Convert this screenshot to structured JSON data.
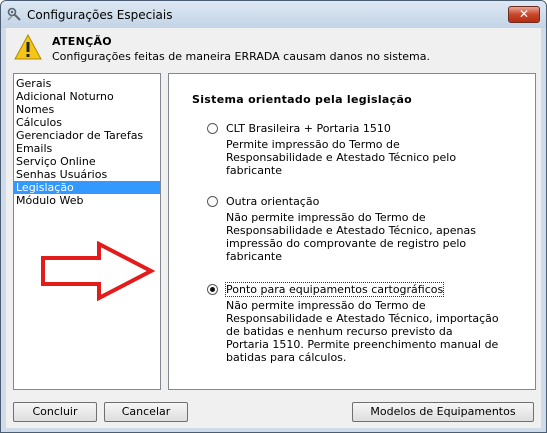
{
  "window": {
    "title": "Configurações Especiais",
    "close_label": "✕"
  },
  "warning": {
    "title": "ATENÇÃO",
    "message": "Configurações feitas de maneira ERRADA causam danos no sistema."
  },
  "sidebar": {
    "items": [
      {
        "label": "Gerais",
        "selected": false
      },
      {
        "label": "Adicional Noturno",
        "selected": false
      },
      {
        "label": "Nomes",
        "selected": false
      },
      {
        "label": "Cálculos",
        "selected": false
      },
      {
        "label": "Gerenciador de Tarefas",
        "selected": false
      },
      {
        "label": "Emails",
        "selected": false
      },
      {
        "label": "Serviço Online",
        "selected": false
      },
      {
        "label": "Senhas Usuários",
        "selected": false
      },
      {
        "label": "Legislação",
        "selected": true
      },
      {
        "label": "Módulo Web",
        "selected": false
      }
    ]
  },
  "panel": {
    "title": "Sistema orientado pela legislação",
    "options": [
      {
        "label": "CLT Brasileira + Portaria 1510",
        "checked": false,
        "description_lines": [
          "Permite impressão do Termo de",
          "Responsabilidade e Atestado Técnico pelo",
          "fabricante"
        ]
      },
      {
        "label": "Outra orientação",
        "checked": false,
        "description_lines": [
          "Não permite impressão do Termo de",
          "Responsabilidade e Atestado Técnico, apenas",
          "impressão do comprovante de registro pelo",
          "fabricante"
        ]
      },
      {
        "label": "Ponto para equipamentos cartográficos",
        "checked": true,
        "description_lines": [
          "Não permite impressão do Termo de",
          "Responsabilidade e Atestado Técnico, importação",
          "de batidas e nenhum recurso previsto da",
          "Portaria 1510. Permite preenchimento manual de",
          "batidas para cálculos."
        ]
      }
    ]
  },
  "buttons": {
    "concluir": "Concluir",
    "cancelar": "Cancelar",
    "modelos": "Modelos de Equipamentos"
  },
  "colors": {
    "selection": "#3399ff",
    "arrow": "#e21b1b",
    "window_frame": "#cfdbe8"
  },
  "icons": {
    "title": "gear-tools-icon",
    "warning": "warning-triangle-icon",
    "annotation": "red-outline-arrow-icon"
  }
}
